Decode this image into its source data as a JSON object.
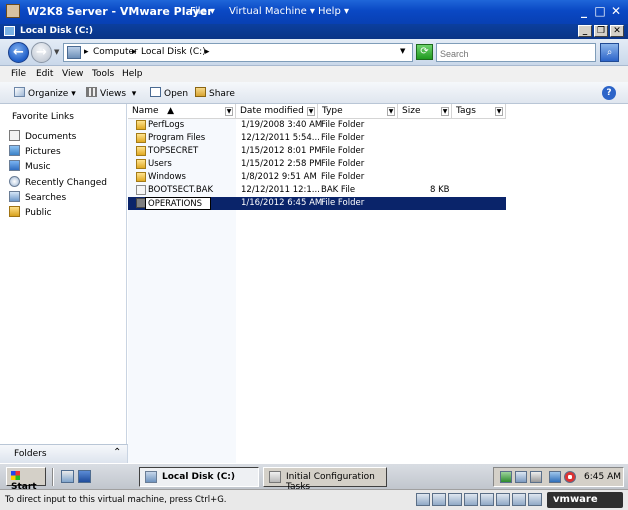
{
  "vmware": {
    "title": "W2K8 Server - VMware Player",
    "menus": [
      "File",
      "Virtual Machine",
      "Help"
    ],
    "status_message": "To direct input to this virtual machine, press Ctrl+G.",
    "logo_text": "vmware"
  },
  "explorer": {
    "window_title": "Local Disk (C:)",
    "address": {
      "segments": [
        "Computer",
        "Local Disk (C:)"
      ]
    },
    "search": {
      "placeholder": "Search"
    },
    "menu": [
      "File",
      "Edit",
      "View",
      "Tools",
      "Help"
    ],
    "toolbar": {
      "organize": "Organize",
      "views": "Views",
      "open": "Open",
      "share": "Share"
    },
    "favorites": {
      "title": "Favorite Links",
      "items": [
        "Documents",
        "Pictures",
        "Music",
        "Recently Changed",
        "Searches",
        "Public"
      ]
    },
    "folders_label": "Folders",
    "columns": [
      "Name",
      "Date modified",
      "Type",
      "Size",
      "Tags"
    ],
    "files": [
      {
        "name": "PerfLogs",
        "date": "1/19/2008 3:40 AM",
        "type": "File Folder",
        "size": ""
      },
      {
        "name": "Program Files",
        "date": "12/12/2011 5:54...",
        "type": "File Folder",
        "size": ""
      },
      {
        "name": "TOPSECRET",
        "date": "1/15/2012 8:01 PM",
        "type": "File Folder",
        "size": ""
      },
      {
        "name": "Users",
        "date": "1/15/2012 2:58 PM",
        "type": "File Folder",
        "size": ""
      },
      {
        "name": "Windows",
        "date": "1/8/2012 9:51 AM",
        "type": "File Folder",
        "size": ""
      },
      {
        "name": "BOOTSECT.BAK",
        "date": "12/12/2011 12:1...",
        "type": "BAK File",
        "size": "8 KB"
      }
    ],
    "renaming": {
      "name": "OPERATIONS",
      "date": "1/16/2012 6:45 AM",
      "type": "File Folder"
    }
  },
  "taskbar": {
    "start": "Start",
    "tasks": [
      "Local Disk (C:)",
      "Initial Configuration Tasks"
    ],
    "clock": "6:45 AM"
  },
  "colors": {
    "selection": "#0a246a",
    "titlebar": "#0a48c4"
  }
}
